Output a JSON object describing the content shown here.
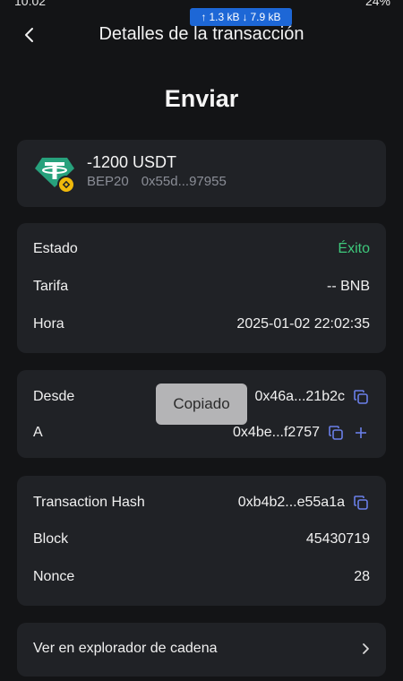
{
  "status_bar": {
    "time": "10:02",
    "right_text": "24%"
  },
  "net_speed": {
    "up": "1.3 kB",
    "down": "7.9 kB"
  },
  "header": {
    "title": "Detalles de la transacción"
  },
  "page_title": "Enviar",
  "token": {
    "amount": "-1200 USDT",
    "network": "BEP20",
    "address": "0x55d...97955"
  },
  "details": {
    "estado_label": "Estado",
    "estado_value": "Éxito",
    "tarifa_label": "Tarifa",
    "tarifa_value": "-- BNB",
    "hora_label": "Hora",
    "hora_value": "2025-01-02 22:02:35"
  },
  "addresses": {
    "desde_label": "Desde",
    "desde_value": "0x46a...21b2c",
    "a_label": "A",
    "a_value": "0x4be...f2757"
  },
  "toast": "Copiado",
  "chain": {
    "hash_label": "Transaction Hash",
    "hash_value": "0xb4b2...e55a1a",
    "block_label": "Block",
    "block_value": "45430719",
    "nonce_label": "Nonce",
    "nonce_value": "28"
  },
  "explorer": {
    "label": "Ver en explorador de cadena"
  },
  "colors": {
    "success": "#3ec97c",
    "accent": "#6a7fe8",
    "tether": "#27a17c",
    "bnb_badge": "#f0b90b"
  }
}
